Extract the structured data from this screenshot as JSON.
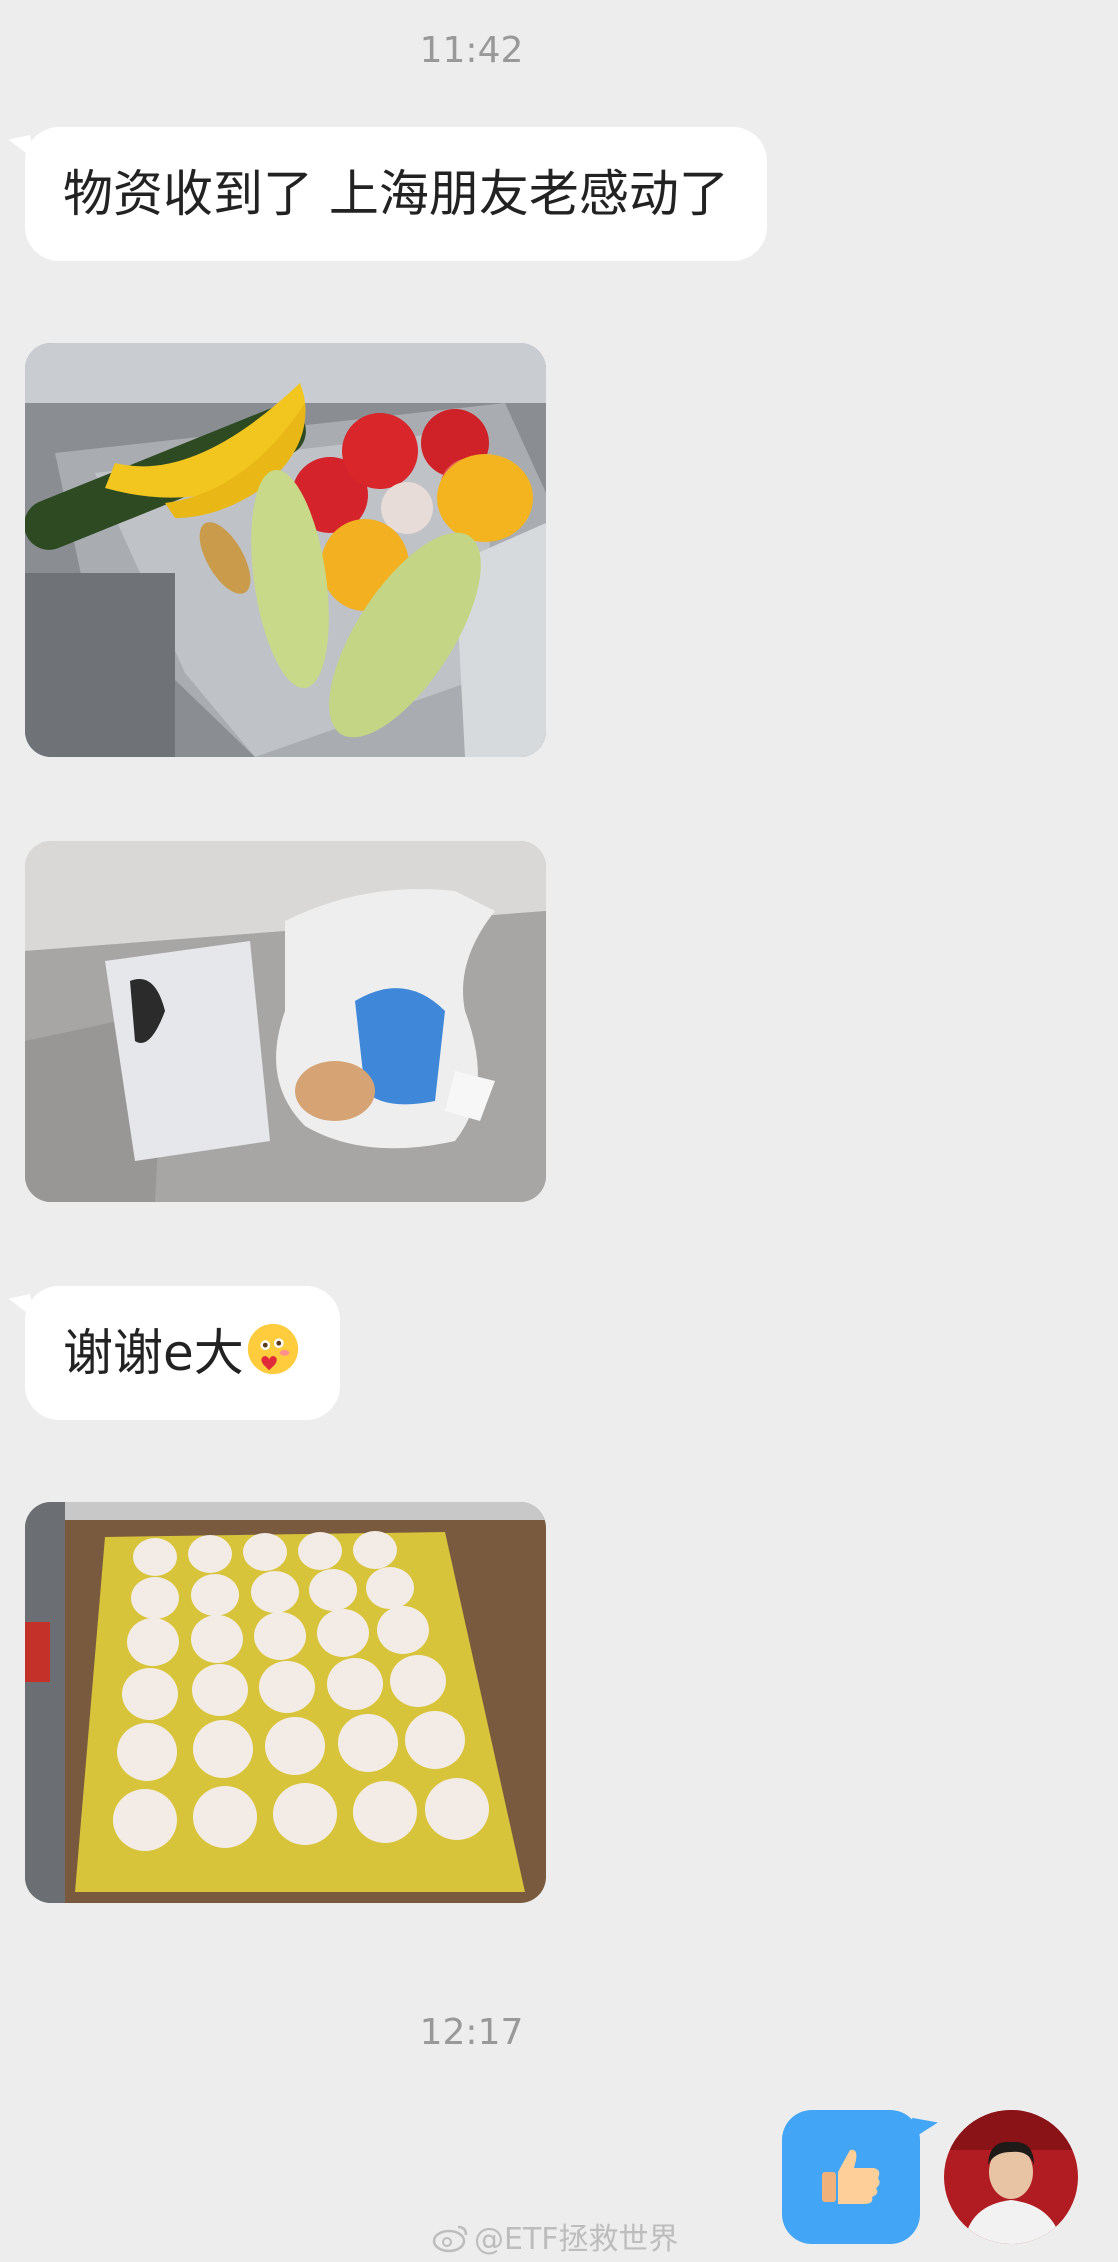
{
  "chat": {
    "timestamp_1": "11:42",
    "message_1": "物资收到了 上海朋友老感动了",
    "message_2": "谢谢e大",
    "message_2_emoji": "shy-blushing-heart-emoji",
    "timestamp_2": "12:17",
    "outgoing_emoji": "thumbs-up-emoji"
  },
  "watermark": {
    "text": "@ETF拯救世界",
    "icon": "weibo-icon"
  },
  "colors": {
    "background": "#ededed",
    "incoming_bubble": "#ffffff",
    "outgoing_bubble": "#42a5f5",
    "timestamp": "#999999"
  }
}
